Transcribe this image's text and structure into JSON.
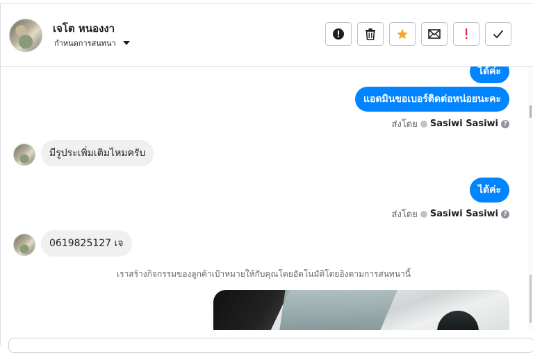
{
  "header": {
    "contact_name": "เจโต หนองงา",
    "contact_sub": "กำหนดการสนทนา"
  },
  "toolbar": {
    "buttons": [
      {
        "name": "spam-button",
        "icon": "alert-circle-icon"
      },
      {
        "name": "delete-button",
        "icon": "trash-icon"
      },
      {
        "name": "star-button",
        "icon": "star-icon",
        "color": "#f5a623"
      },
      {
        "name": "mark-unread-button",
        "icon": "envelope-icon"
      },
      {
        "name": "important-button",
        "icon": "exclamation-icon",
        "color": "#e41e3f"
      },
      {
        "name": "mark-done-button",
        "icon": "check-icon"
      }
    ]
  },
  "messages": [
    {
      "direction": "out",
      "text": "ได้ค่ะ"
    },
    {
      "direction": "out",
      "text": "แอดมินขอเบอร์ติดต่อหน่อยนะคะ"
    },
    {
      "direction": "out-meta",
      "prefix": "ส่งโดย",
      "sender": "Sasiwi Sasiwi"
    },
    {
      "direction": "in",
      "text": "มีรูประเพิ่มเติมไหมครับ"
    },
    {
      "direction": "out",
      "text": "ได้ค่ะ"
    },
    {
      "direction": "out-meta",
      "prefix": "ส่งโดย",
      "sender": "Sasiwi Sasiwi"
    },
    {
      "direction": "in",
      "text": "0619825127 เจ"
    },
    {
      "direction": "system",
      "text": "เราสร้างกิจกรรมของลูกค้าเป้าหมายให้กับคุณโดยอัตโนมัติโดยอิงตามการสนทนานี้"
    }
  ],
  "colors": {
    "outgoing_bubble": "#0084ff",
    "incoming_bubble": "#f0f0f0",
    "star": "#f5a623",
    "important": "#e41e3f"
  }
}
